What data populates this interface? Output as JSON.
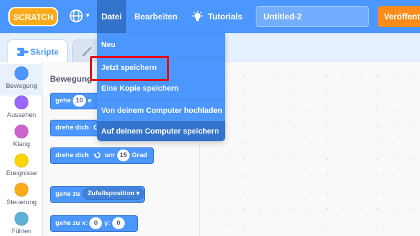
{
  "menubar": {
    "logo": "SCRATCH",
    "language_icon": "globe-icon",
    "file_menu": "Datei",
    "edit_menu": "Bearbeiten",
    "tutorials": "Tutorials",
    "project_title": "Untitled-2",
    "share_button": "Veröffentl"
  },
  "tabs": {
    "code": "Skripte",
    "costumes_icon": "brush-icon"
  },
  "categories": [
    {
      "label": "Bewegung",
      "color": "#4c97ff"
    },
    {
      "label": "Aussehen",
      "color": "#9966ff"
    },
    {
      "label": "Klang",
      "color": "#cf63cf"
    },
    {
      "label": "Ereignisse",
      "color": "#ffd500"
    },
    {
      "label": "Steuerung",
      "color": "#ffab19"
    },
    {
      "label": "Fühlen",
      "color": "#5cb1d6"
    }
  ],
  "palette": {
    "heading": "Bewegung",
    "blocks": [
      {
        "text": "gehe",
        "value": "10",
        "suffix": "e"
      },
      {
        "text": "drehe dich"
      },
      {
        "text": "drehe dich",
        "mid": "um",
        "value": "15",
        "suffix": "Grad"
      },
      {
        "text": "gehe zu",
        "dropdown": "Zufallsposition"
      },
      {
        "text": "gehe zu x:",
        "x_value": "0",
        "y_label": "y:",
        "y_value": "0"
      }
    ]
  },
  "file_menu": {
    "items": [
      "Neu",
      "Jetzt speichern",
      "Eine Kopie speichern",
      "Von deinem Computer hochladen",
      "Auf deinem Computer speichern"
    ],
    "highlighted_item": "Jetzt speichern",
    "hovered_item": "Auf deinem Computer speichern"
  },
  "colors": {
    "menu_blue": "#4c97ff",
    "menu_active": "#3373cc",
    "share_orange": "#ff8c1a",
    "highlight_red": "#e4001b"
  }
}
